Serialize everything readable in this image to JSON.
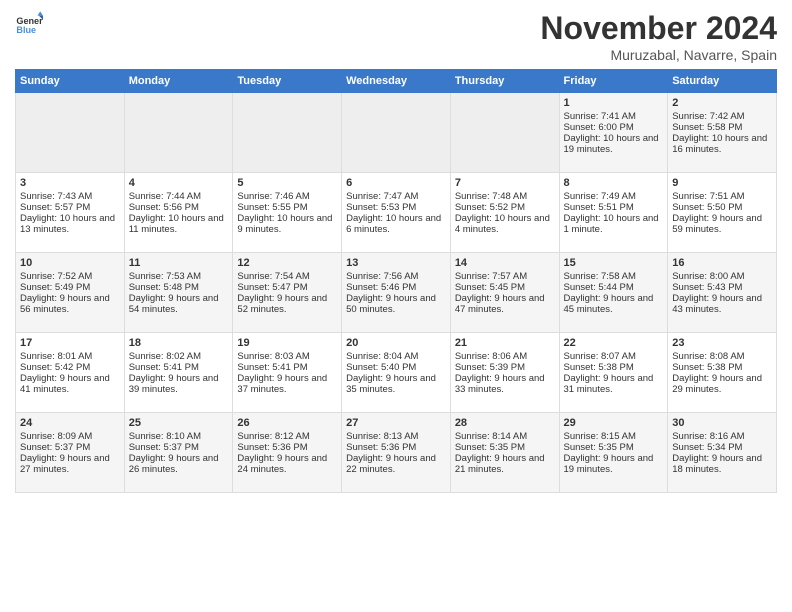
{
  "header": {
    "logo_general": "General",
    "logo_blue": "Blue",
    "month": "November 2024",
    "location": "Muruzabal, Navarre, Spain"
  },
  "weekdays": [
    "Sunday",
    "Monday",
    "Tuesday",
    "Wednesday",
    "Thursday",
    "Friday",
    "Saturday"
  ],
  "weeks": [
    [
      {
        "day": "",
        "empty": true
      },
      {
        "day": "",
        "empty": true
      },
      {
        "day": "",
        "empty": true
      },
      {
        "day": "",
        "empty": true
      },
      {
        "day": "",
        "empty": true
      },
      {
        "day": "1",
        "rise": "7:41 AM",
        "set": "6:00 PM",
        "daylight": "10 hours and 19 minutes."
      },
      {
        "day": "2",
        "rise": "7:42 AM",
        "set": "5:58 PM",
        "daylight": "10 hours and 16 minutes."
      }
    ],
    [
      {
        "day": "3",
        "rise": "7:43 AM",
        "set": "5:57 PM",
        "daylight": "10 hours and 13 minutes."
      },
      {
        "day": "4",
        "rise": "7:44 AM",
        "set": "5:56 PM",
        "daylight": "10 hours and 11 minutes."
      },
      {
        "day": "5",
        "rise": "7:46 AM",
        "set": "5:55 PM",
        "daylight": "10 hours and 9 minutes."
      },
      {
        "day": "6",
        "rise": "7:47 AM",
        "set": "5:53 PM",
        "daylight": "10 hours and 6 minutes."
      },
      {
        "day": "7",
        "rise": "7:48 AM",
        "set": "5:52 PM",
        "daylight": "10 hours and 4 minutes."
      },
      {
        "day": "8",
        "rise": "7:49 AM",
        "set": "5:51 PM",
        "daylight": "10 hours and 1 minute."
      },
      {
        "day": "9",
        "rise": "7:51 AM",
        "set": "5:50 PM",
        "daylight": "9 hours and 59 minutes."
      }
    ],
    [
      {
        "day": "10",
        "rise": "7:52 AM",
        "set": "5:49 PM",
        "daylight": "9 hours and 56 minutes."
      },
      {
        "day": "11",
        "rise": "7:53 AM",
        "set": "5:48 PM",
        "daylight": "9 hours and 54 minutes."
      },
      {
        "day": "12",
        "rise": "7:54 AM",
        "set": "5:47 PM",
        "daylight": "9 hours and 52 minutes."
      },
      {
        "day": "13",
        "rise": "7:56 AM",
        "set": "5:46 PM",
        "daylight": "9 hours and 50 minutes."
      },
      {
        "day": "14",
        "rise": "7:57 AM",
        "set": "5:45 PM",
        "daylight": "9 hours and 47 minutes."
      },
      {
        "day": "15",
        "rise": "7:58 AM",
        "set": "5:44 PM",
        "daylight": "9 hours and 45 minutes."
      },
      {
        "day": "16",
        "rise": "8:00 AM",
        "set": "5:43 PM",
        "daylight": "9 hours and 43 minutes."
      }
    ],
    [
      {
        "day": "17",
        "rise": "8:01 AM",
        "set": "5:42 PM",
        "daylight": "9 hours and 41 minutes."
      },
      {
        "day": "18",
        "rise": "8:02 AM",
        "set": "5:41 PM",
        "daylight": "9 hours and 39 minutes."
      },
      {
        "day": "19",
        "rise": "8:03 AM",
        "set": "5:41 PM",
        "daylight": "9 hours and 37 minutes."
      },
      {
        "day": "20",
        "rise": "8:04 AM",
        "set": "5:40 PM",
        "daylight": "9 hours and 35 minutes."
      },
      {
        "day": "21",
        "rise": "8:06 AM",
        "set": "5:39 PM",
        "daylight": "9 hours and 33 minutes."
      },
      {
        "day": "22",
        "rise": "8:07 AM",
        "set": "5:38 PM",
        "daylight": "9 hours and 31 minutes."
      },
      {
        "day": "23",
        "rise": "8:08 AM",
        "set": "5:38 PM",
        "daylight": "9 hours and 29 minutes."
      }
    ],
    [
      {
        "day": "24",
        "rise": "8:09 AM",
        "set": "5:37 PM",
        "daylight": "9 hours and 27 minutes."
      },
      {
        "day": "25",
        "rise": "8:10 AM",
        "set": "5:37 PM",
        "daylight": "9 hours and 26 minutes."
      },
      {
        "day": "26",
        "rise": "8:12 AM",
        "set": "5:36 PM",
        "daylight": "9 hours and 24 minutes."
      },
      {
        "day": "27",
        "rise": "8:13 AM",
        "set": "5:36 PM",
        "daylight": "9 hours and 22 minutes."
      },
      {
        "day": "28",
        "rise": "8:14 AM",
        "set": "5:35 PM",
        "daylight": "9 hours and 21 minutes."
      },
      {
        "day": "29",
        "rise": "8:15 AM",
        "set": "5:35 PM",
        "daylight": "9 hours and 19 minutes."
      },
      {
        "day": "30",
        "rise": "8:16 AM",
        "set": "5:34 PM",
        "daylight": "9 hours and 18 minutes."
      }
    ]
  ]
}
